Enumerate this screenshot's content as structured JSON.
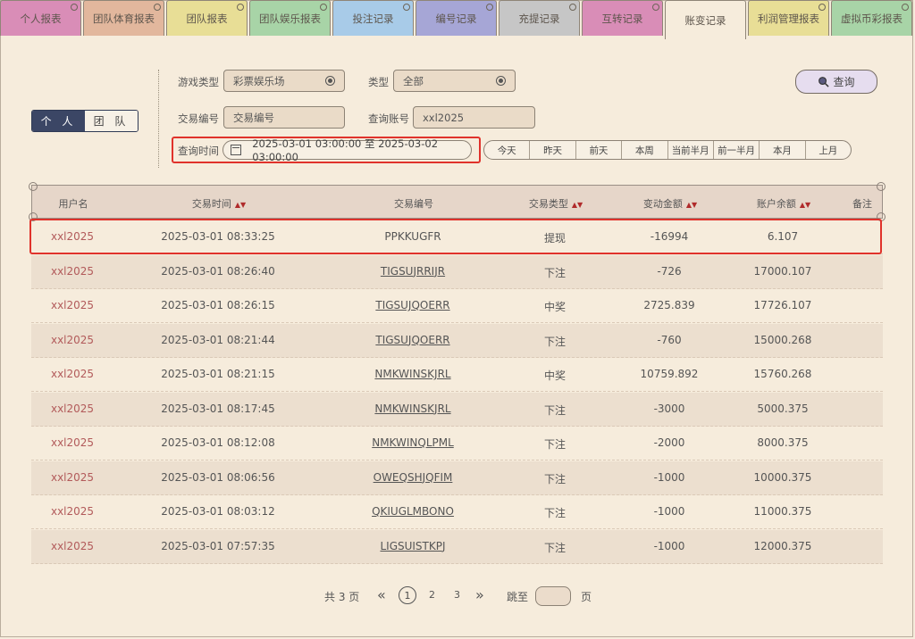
{
  "tabs": [
    {
      "label": "个人报表",
      "color": "#d98db7"
    },
    {
      "label": "团队体育报表",
      "color": "#e2b79d"
    },
    {
      "label": "团队报表",
      "color": "#e8de96"
    },
    {
      "label": "团队娱乐报表",
      "color": "#a8d4a7"
    },
    {
      "label": "投注记录",
      "color": "#a8cbe8"
    },
    {
      "label": "编号记录",
      "color": "#a6a6d6"
    },
    {
      "label": "充提记录",
      "color": "#c6c6c6"
    },
    {
      "label": "互转记录",
      "color": "#d98db7"
    },
    {
      "label": "账变记录",
      "color": "#f6ecdc"
    },
    {
      "label": "利润管理报表",
      "color": "#e8de96"
    },
    {
      "label": "虚拟币彩报表",
      "color": "#a8d4a7"
    }
  ],
  "scope": {
    "personal": "个 人",
    "team": "团 队"
  },
  "filters": {
    "game_type_label": "游戏类型",
    "game_type_value": "彩票娱乐场",
    "type_label": "类型",
    "type_value": "全部",
    "txn_no_label": "交易编号",
    "txn_no_placeholder": "交易编号",
    "account_label": "查询账号",
    "account_value": "xxl2025",
    "time_label": "查询时间",
    "time_value": "2025-03-01 03:00:00 至 2025-03-02 03:00:00",
    "search_label": "查询",
    "quick_ranges": [
      "今天",
      "昨天",
      "前天",
      "本周",
      "当前半月",
      "前一半月",
      "本月",
      "上月"
    ]
  },
  "table": {
    "headers": [
      "用户名",
      "交易时间",
      "交易编号",
      "交易类型",
      "变动金额",
      "账户余额",
      "备注"
    ],
    "rows": [
      [
        "xxl2025",
        "2025-03-01 08:33:25",
        "PPKKUGFR",
        "提现",
        "-16994",
        "6.107",
        ""
      ],
      [
        "xxl2025",
        "2025-03-01 08:26:40",
        "TIGSUJRRIJR",
        "下注",
        "-726",
        "17000.107",
        ""
      ],
      [
        "xxl2025",
        "2025-03-01 08:26:15",
        "TIGSUJQOERR",
        "中奖",
        "2725.839",
        "17726.107",
        ""
      ],
      [
        "xxl2025",
        "2025-03-01 08:21:44",
        "TIGSUJQOERR",
        "下注",
        "-760",
        "15000.268",
        ""
      ],
      [
        "xxl2025",
        "2025-03-01 08:21:15",
        "NMKWINSKJRL",
        "中奖",
        "10759.892",
        "15760.268",
        ""
      ],
      [
        "xxl2025",
        "2025-03-01 08:17:45",
        "NMKWINSKJRL",
        "下注",
        "-3000",
        "5000.375",
        ""
      ],
      [
        "xxl2025",
        "2025-03-01 08:12:08",
        "NMKWINQLPML",
        "下注",
        "-2000",
        "8000.375",
        ""
      ],
      [
        "xxl2025",
        "2025-03-01 08:06:56",
        "OWEQSHJQFIM",
        "下注",
        "-1000",
        "10000.375",
        ""
      ],
      [
        "xxl2025",
        "2025-03-01 08:03:12",
        "QKIUGLMBONO",
        "下注",
        "-1000",
        "11000.375",
        ""
      ],
      [
        "xxl2025",
        "2025-03-01 07:57:35",
        "LIGSUISTKPJ",
        "下注",
        "-1000",
        "12000.375",
        ""
      ]
    ]
  },
  "pagination": {
    "total": "共 3 页",
    "prev": "«",
    "pages": [
      "1",
      "2",
      "3"
    ],
    "next": "»",
    "jump_label": "跳至",
    "page_unit": "页"
  }
}
